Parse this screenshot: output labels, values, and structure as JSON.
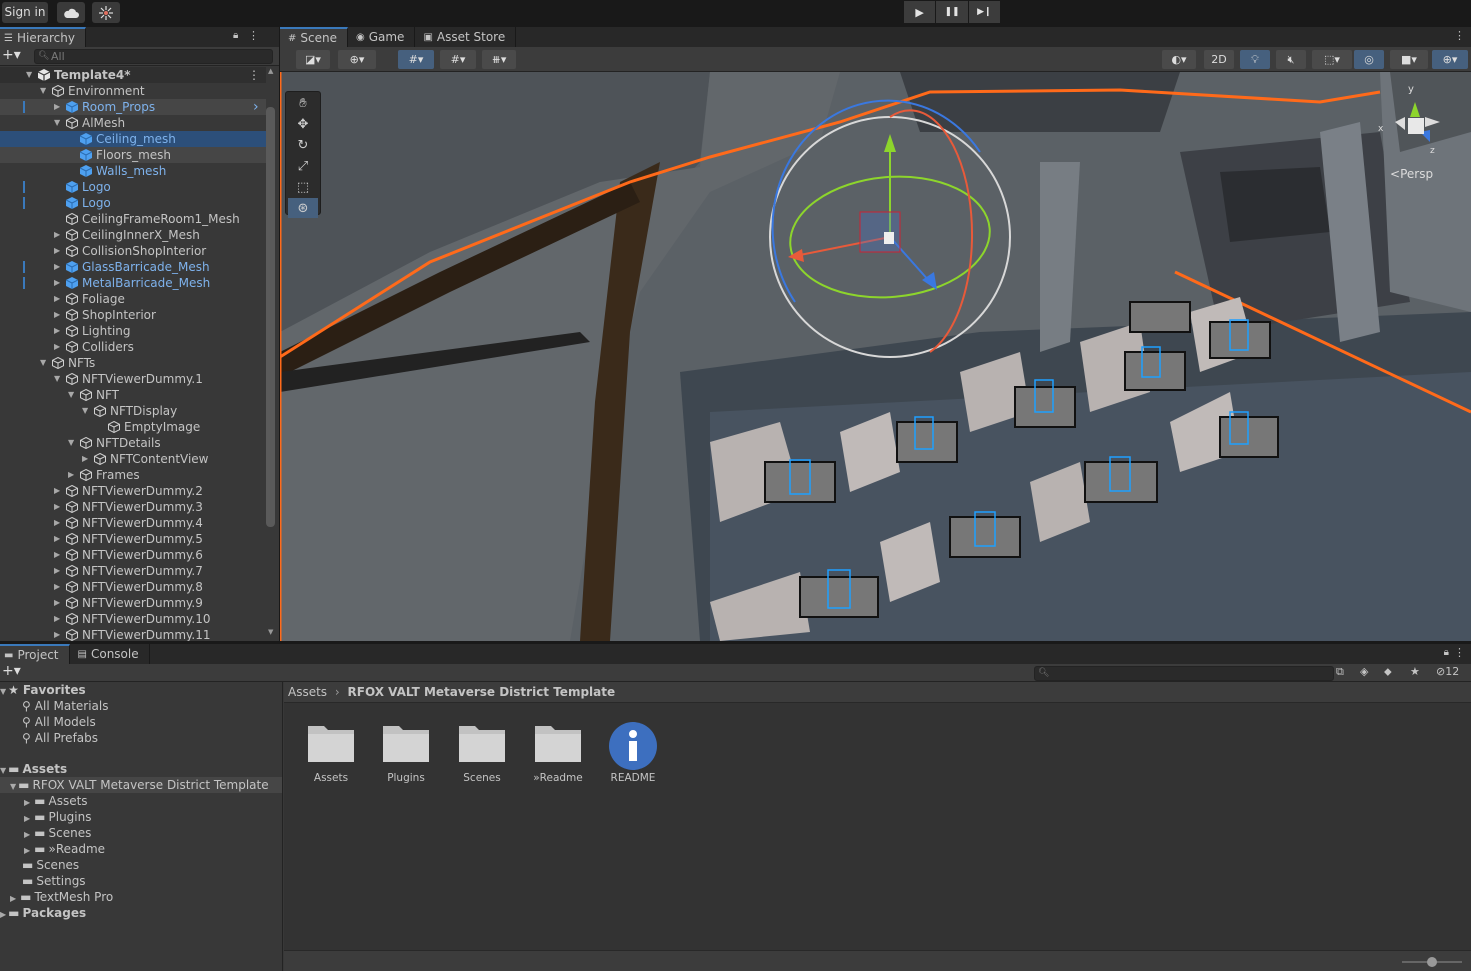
{
  "toolbar": {
    "sign_in": "Sign in",
    "cloud_icon": "cloud-icon",
    "collab_icon": "collab-icon",
    "play": "▶",
    "pause": "❚❚",
    "step": "▶❙"
  },
  "hierarchy": {
    "tab_label": "Hierarchy",
    "search_placeholder": "All",
    "rows": [
      {
        "label": "Template4*"
      },
      {
        "label": "Environment"
      },
      {
        "label": "Room_Props"
      },
      {
        "label": "AlMesh"
      },
      {
        "label": "Ceiling_mesh"
      },
      {
        "label": "Floors_mesh"
      },
      {
        "label": "Walls_mesh"
      },
      {
        "label": "Logo"
      },
      {
        "label": "Logo"
      },
      {
        "label": "CeilingFrameRoom1_Mesh"
      },
      {
        "label": "CeilingInnerX_Mesh"
      },
      {
        "label": "CollisionShopInterior"
      },
      {
        "label": "GlassBarricade_Mesh"
      },
      {
        "label": "MetalBarricade_Mesh"
      },
      {
        "label": "Foliage"
      },
      {
        "label": "ShopInterior"
      },
      {
        "label": "Lighting"
      },
      {
        "label": "Colliders"
      },
      {
        "label": "NFTs"
      },
      {
        "label": "NFTViewerDummy.1"
      },
      {
        "label": "NFT"
      },
      {
        "label": "NFTDisplay"
      },
      {
        "label": "EmptyImage"
      },
      {
        "label": "NFTDetails"
      },
      {
        "label": "NFTContentView"
      },
      {
        "label": "Frames"
      },
      {
        "label": "NFTViewerDummy.2"
      },
      {
        "label": "NFTViewerDummy.3"
      },
      {
        "label": "NFTViewerDummy.4"
      },
      {
        "label": "NFTViewerDummy.5"
      },
      {
        "label": "NFTViewerDummy.6"
      },
      {
        "label": "NFTViewerDummy.7"
      },
      {
        "label": "NFTViewerDummy.8"
      },
      {
        "label": "NFTViewerDummy.9"
      },
      {
        "label": "NFTViewerDummy.10"
      },
      {
        "label": "NFTViewerDummy.11"
      }
    ]
  },
  "scene": {
    "tabs": [
      "Scene",
      "Game",
      "Asset Store"
    ],
    "mode_2d": "2D",
    "persp_label": "Persp",
    "gizmo_axes": {
      "y": "y",
      "x": "x",
      "z": "z"
    }
  },
  "project": {
    "tabs": [
      "Project",
      "Console"
    ],
    "hidden_count": "12",
    "favorites_label": "Favorites",
    "favorites": [
      "All Materials",
      "All Models",
      "All Prefabs"
    ],
    "assets_label": "Assets",
    "tree": [
      {
        "label": "RFOX VALT Metaverse District Template"
      },
      {
        "label": "Assets"
      },
      {
        "label": "Plugins"
      },
      {
        "label": "Scenes"
      },
      {
        "label": "»Readme"
      },
      {
        "label": "Scenes"
      },
      {
        "label": "Settings"
      },
      {
        "label": "TextMesh Pro"
      }
    ],
    "packages_label": "Packages",
    "breadcrumb": [
      "Assets",
      "RFOX VALT Metaverse District Template"
    ],
    "items": [
      {
        "label": "Assets",
        "icon": "folder-icon"
      },
      {
        "label": "Plugins",
        "icon": "folder-icon"
      },
      {
        "label": "Scenes",
        "icon": "folder-icon"
      },
      {
        "label": "»Readme",
        "icon": "folder-icon"
      },
      {
        "label": "README",
        "icon": "info-icon"
      }
    ]
  },
  "colors": {
    "selection_blue": "#3a79bb",
    "prefab_blue": "#7eb2ec",
    "selection_outline": "#ff6a00"
  }
}
